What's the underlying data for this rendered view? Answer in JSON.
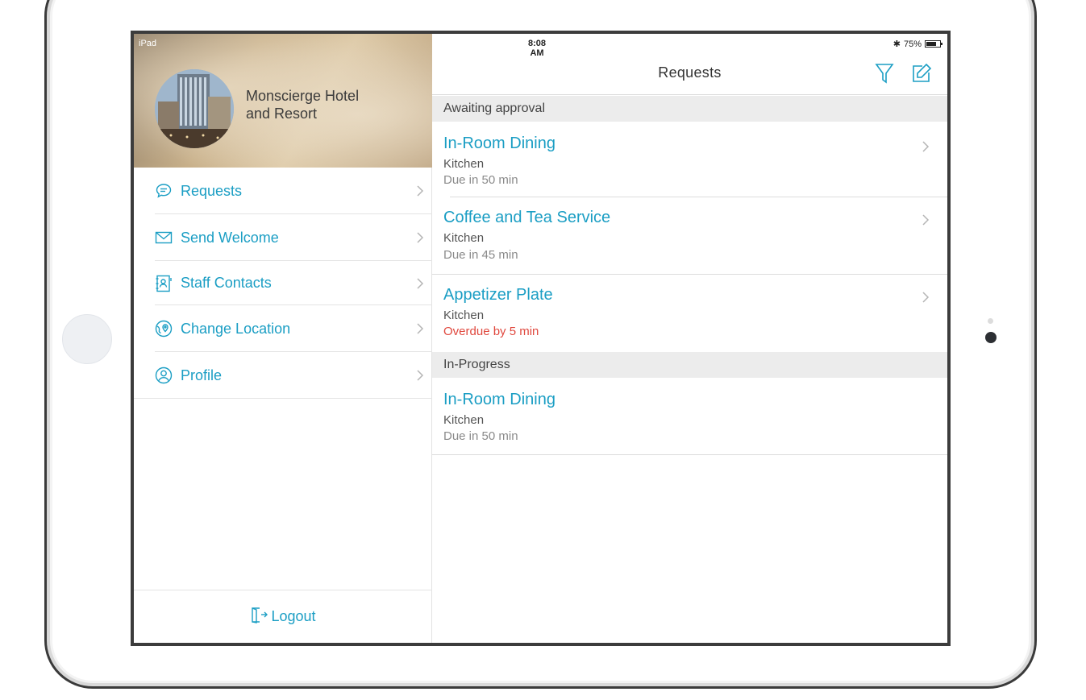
{
  "status_bar": {
    "device": "iPad",
    "time": "8:08 AM",
    "battery": "75%",
    "battery_level": 0.75
  },
  "sidebar": {
    "hotel_name_line1": "Monscierge Hotel",
    "hotel_name_line2": "and Resort",
    "items": [
      {
        "label": "Requests",
        "icon": "chat-bubble-icon"
      },
      {
        "label": "Send Welcome",
        "icon": "envelope-icon"
      },
      {
        "label": "Staff Contacts",
        "icon": "contact-book-icon"
      },
      {
        "label": "Change Location",
        "icon": "location-pin-icon"
      },
      {
        "label": "Profile",
        "icon": "user-circle-icon"
      }
    ],
    "logout_label": "Logout"
  },
  "main": {
    "title": "Requests",
    "sections": [
      {
        "header": "Awaiting approval",
        "items": [
          {
            "title": "In-Room Dining",
            "department": "Kitchen",
            "due": "Due in 50 min",
            "overdue": false
          },
          {
            "title": "Coffee and Tea Service",
            "department": "Kitchen",
            "due": "Due in 45 min",
            "overdue": false
          },
          {
            "title": "Appetizer Plate",
            "department": "Kitchen",
            "due": "Overdue by 5 min",
            "overdue": true
          }
        ]
      },
      {
        "header": "In-Progress",
        "items": [
          {
            "title": "In-Room Dining",
            "department": "Kitchen",
            "due": "Due in 50 min",
            "overdue": false
          }
        ]
      }
    ]
  },
  "colors": {
    "accent": "#1b9ec4",
    "overdue": "#e0483e",
    "section_bg": "#ececec"
  }
}
